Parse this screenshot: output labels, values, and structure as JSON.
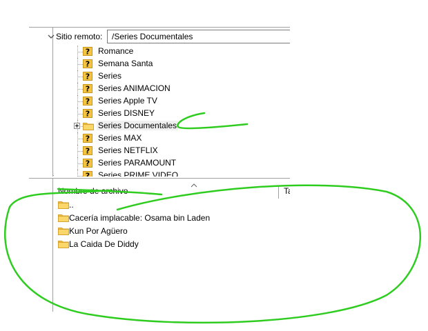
{
  "remote": {
    "label": "Sitio remoto:",
    "path": "/Series Documentales"
  },
  "tree": {
    "items": [
      {
        "label": "Romance",
        "icon": "question-folder-icon"
      },
      {
        "label": "Semana Santa",
        "icon": "question-folder-icon"
      },
      {
        "label": "Series",
        "icon": "question-folder-icon"
      },
      {
        "label": "Series ANIMACION",
        "icon": "question-folder-icon"
      },
      {
        "label": "Series Apple TV",
        "icon": "question-folder-icon"
      },
      {
        "label": "Series DISNEY",
        "icon": "question-folder-icon"
      },
      {
        "label": "Series Documentales",
        "icon": "folder-icon",
        "selected": true,
        "expandable": true
      },
      {
        "label": "Series MAX",
        "icon": "question-folder-icon"
      },
      {
        "label": "Series NETFLIX",
        "icon": "question-folder-icon"
      },
      {
        "label": "Series PARAMOUNT",
        "icon": "question-folder-icon"
      },
      {
        "label": "Series PRIME VIDEO",
        "icon": "question-folder-icon"
      }
    ]
  },
  "file_list": {
    "columns": {
      "name": "Nombre de archivo",
      "size": "Ta"
    },
    "rows": [
      {
        "name": ".."
      },
      {
        "name": "Cacería implacable: Osama bin Laden"
      },
      {
        "name": "Kun Por Agüero"
      },
      {
        "name": "La Caida De Diddy"
      }
    ]
  },
  "colors": {
    "annotation": "#2ecc1f",
    "folder": "#f5c342",
    "selection": "#f0f0f0"
  }
}
